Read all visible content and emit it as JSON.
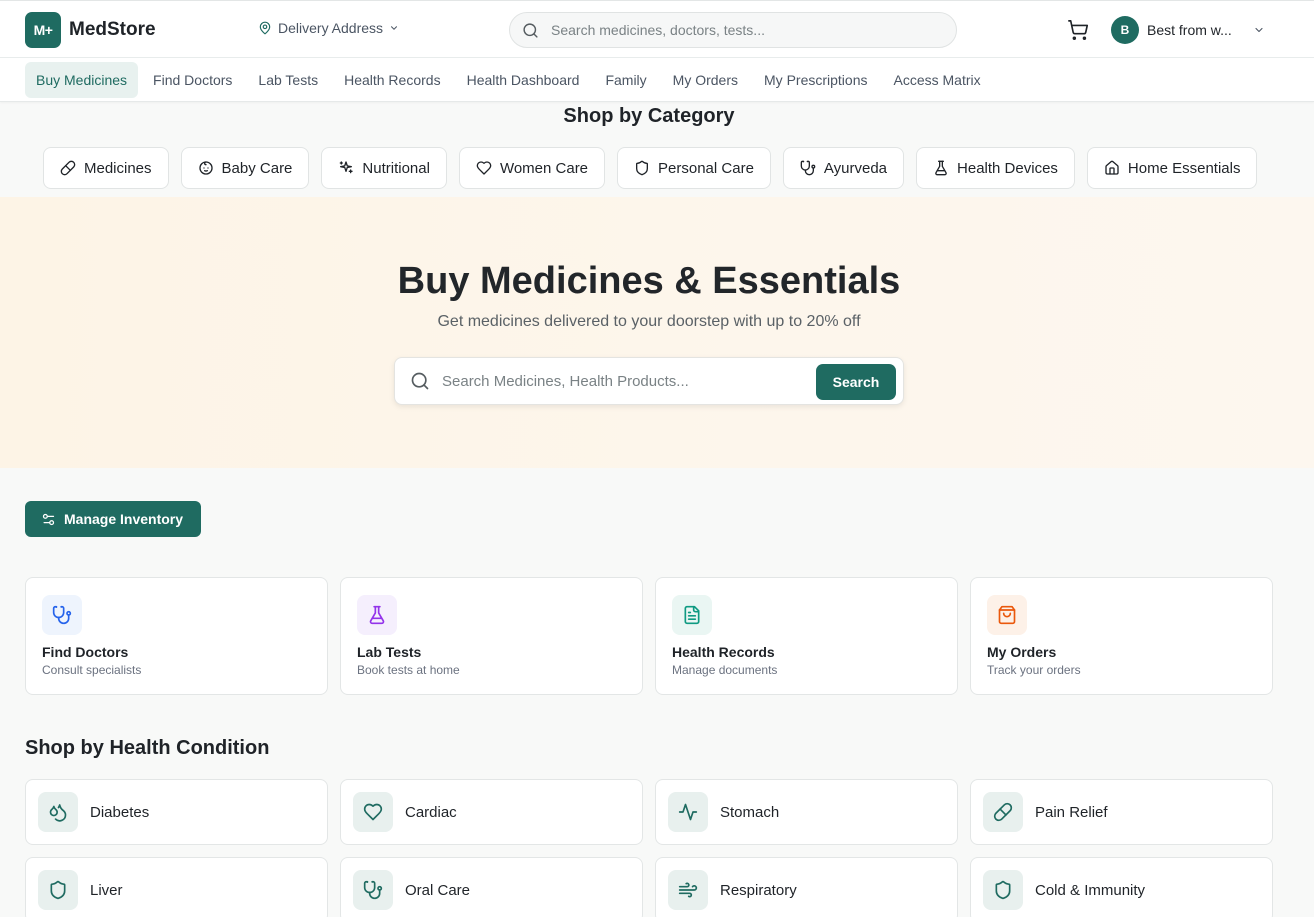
{
  "header": {
    "logo_mark": "M+",
    "logo_text": "MedStore",
    "delivery_label": "Delivery Address",
    "search_placeholder": "Search medicines, doctors, tests...",
    "user_initial": "B",
    "user_name": "Best from w..."
  },
  "nav": {
    "items": [
      {
        "label": "Buy Medicines",
        "active": true
      },
      {
        "label": "Find Doctors"
      },
      {
        "label": "Lab Tests"
      },
      {
        "label": "Health Records"
      },
      {
        "label": "Health Dashboard"
      },
      {
        "label": "Family"
      },
      {
        "label": "My Orders"
      },
      {
        "label": "My Prescriptions"
      },
      {
        "label": "Access Matrix"
      }
    ]
  },
  "categories": {
    "title": "Shop by Category",
    "items": [
      {
        "label": "Medicines",
        "icon": "pill-icon"
      },
      {
        "label": "Baby Care",
        "icon": "baby-icon"
      },
      {
        "label": "Nutritional",
        "icon": "sparkles-icon"
      },
      {
        "label": "Women Care",
        "icon": "heart-icon"
      },
      {
        "label": "Personal Care",
        "icon": "shield-icon"
      },
      {
        "label": "Ayurveda",
        "icon": "stethoscope-icon"
      },
      {
        "label": "Health Devices",
        "icon": "flask-icon"
      },
      {
        "label": "Home Essentials",
        "icon": "home-icon"
      }
    ]
  },
  "hero": {
    "title": "Buy Medicines & Essentials",
    "subtitle": "Get medicines delivered to your doorstep with up to 20% off",
    "search_placeholder": "Search Medicines, Health Products...",
    "search_button": "Search"
  },
  "manage_inventory": "Manage Inventory",
  "quick_links": [
    {
      "title": "Find Doctors",
      "subtitle": "Consult specialists",
      "icon": "stethoscope-icon",
      "bg": "#eef4fd",
      "color": "#2563eb"
    },
    {
      "title": "Lab Tests",
      "subtitle": "Book tests at home",
      "icon": "flask-icon",
      "bg": "#f5effd",
      "color": "#9333ea"
    },
    {
      "title": "Health Records",
      "subtitle": "Manage documents",
      "icon": "file-icon",
      "bg": "#eaf6f3",
      "color": "#0f9a82"
    },
    {
      "title": "My Orders",
      "subtitle": "Track your orders",
      "icon": "shopping-bag-icon",
      "bg": "#fdf1e8",
      "color": "#ea580c"
    }
  ],
  "health_conditions": {
    "title": "Shop by Health Condition",
    "items": [
      {
        "label": "Diabetes",
        "icon": "droplets-icon"
      },
      {
        "label": "Cardiac",
        "icon": "heart-icon"
      },
      {
        "label": "Stomach",
        "icon": "activity-icon"
      },
      {
        "label": "Pain Relief",
        "icon": "pill-icon"
      },
      {
        "label": "Liver",
        "icon": "shield-icon"
      },
      {
        "label": "Oral Care",
        "icon": "stethoscope-icon"
      },
      {
        "label": "Respiratory",
        "icon": "wind-icon"
      },
      {
        "label": "Cold & Immunity",
        "icon": "shield-icon"
      }
    ]
  },
  "colors": {
    "brand": "#1f6b61",
    "nav_active_bg": "#e8f1ef"
  }
}
